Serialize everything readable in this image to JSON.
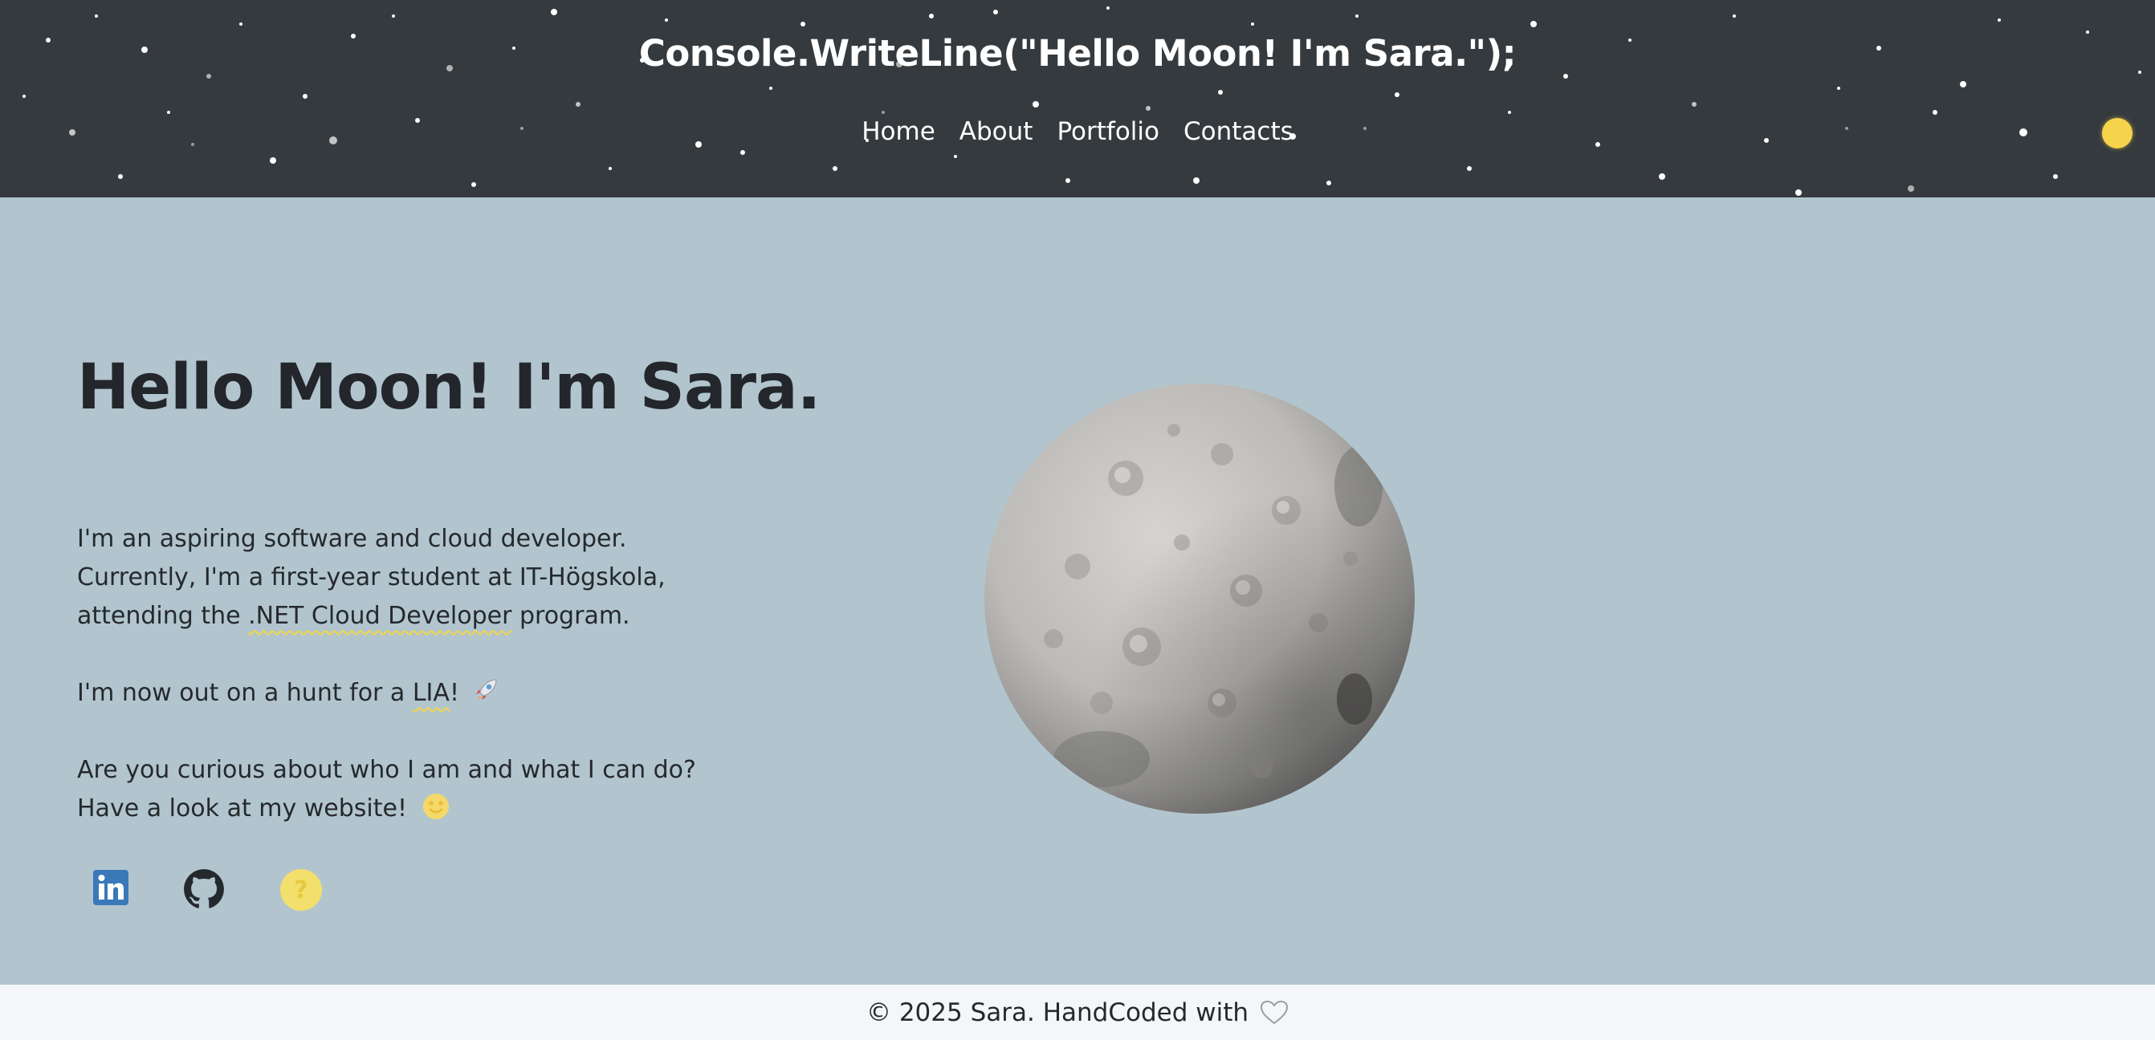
{
  "header": {
    "site_title": "Console.WriteLine(\"Hello Moon! I'm Sara.\");",
    "nav": [
      {
        "label": "Home"
      },
      {
        "label": "About"
      },
      {
        "label": "Portfolio"
      },
      {
        "label": "Contacts"
      }
    ],
    "theme_toggle_icon": "sun-icon",
    "background_color": "#353a3e"
  },
  "hero": {
    "title": "Hello Moon! I'm Sara.",
    "paragraph1": {
      "line1": "I'm an aspiring software and cloud developer.",
      "line2": "Currently, I'm a first-year student at IT-Högskola,",
      "line3_before": "attending the ",
      "line3_link": ".NET Cloud Developer",
      "line3_after": " program."
    },
    "paragraph2": {
      "before": "I'm now out on a hunt for a ",
      "link": "LIA",
      "after": "!",
      "emoji_icon": "rocket-icon"
    },
    "paragraph3": {
      "line1": "Are you curious about who I am and what I can do?",
      "line2": "Have a look at my website!",
      "emoji_icon": "smiley-icon"
    },
    "image_icon": "moon-image",
    "socials": [
      {
        "icon": "linkedin-icon",
        "label": "in"
      },
      {
        "icon": "github-icon"
      },
      {
        "icon": "question-icon",
        "label": "?"
      }
    ]
  },
  "footer": {
    "text": "© 2025 Sara. HandCoded with",
    "icon": "heart-icon"
  },
  "colors": {
    "accent": "#f5d34b",
    "page_background": "#b2c5ce",
    "linkedin": "#3a78b8",
    "footer_background": "#f5f6f8"
  }
}
